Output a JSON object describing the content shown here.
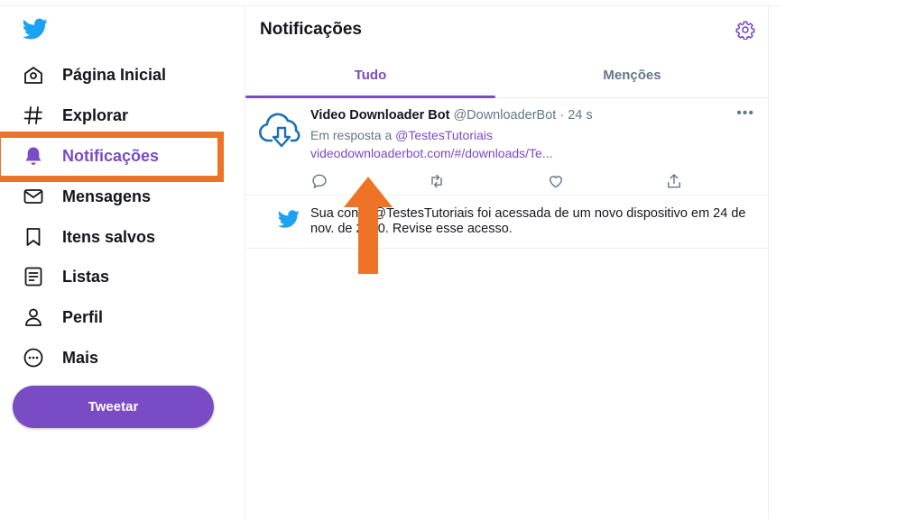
{
  "colors": {
    "accent": "#794bc4",
    "highlight": "#ee7326",
    "twitter_blue": "#1da1f2",
    "muted": "#657786"
  },
  "sidebar": {
    "logo_icon": "twitter-bird-icon",
    "items": [
      {
        "label": "Página Inicial",
        "icon": "home-icon"
      },
      {
        "label": "Explorar",
        "icon": "hashtag-icon"
      },
      {
        "label": "Notificações",
        "icon": "bell-icon",
        "active": true
      },
      {
        "label": "Mensagens",
        "icon": "envelope-icon"
      },
      {
        "label": "Itens salvos",
        "icon": "bookmark-icon"
      },
      {
        "label": "Listas",
        "icon": "list-icon"
      },
      {
        "label": "Perfil",
        "icon": "person-icon"
      },
      {
        "label": "Mais",
        "icon": "more-circle-icon"
      }
    ],
    "tweet_button": "Tweetar"
  },
  "main": {
    "title": "Notificações",
    "settings_icon": "gear-icon",
    "tabs": [
      {
        "label": "Tudo",
        "active": true
      },
      {
        "label": "Menções",
        "active": false
      }
    ],
    "notifications": [
      {
        "name": "Video Downloader Bot",
        "handle": "@DownloaderBot",
        "separator": "·",
        "time": "24 s",
        "reply_prefix": "Em resposta a",
        "reply_mention": "@TestesTutoriais",
        "link": "videodownloaderbot.com/#/downloads/Te...",
        "more": "•••",
        "actions": [
          "reply-icon",
          "retweet-icon",
          "like-icon",
          "share-icon"
        ]
      },
      {
        "text_line1": "Sua conta @TestesTutoriais foi acessada de um novo dispositivo em 24 de",
        "text_line2": "nov. de 2020. Revise esse acesso."
      }
    ]
  }
}
